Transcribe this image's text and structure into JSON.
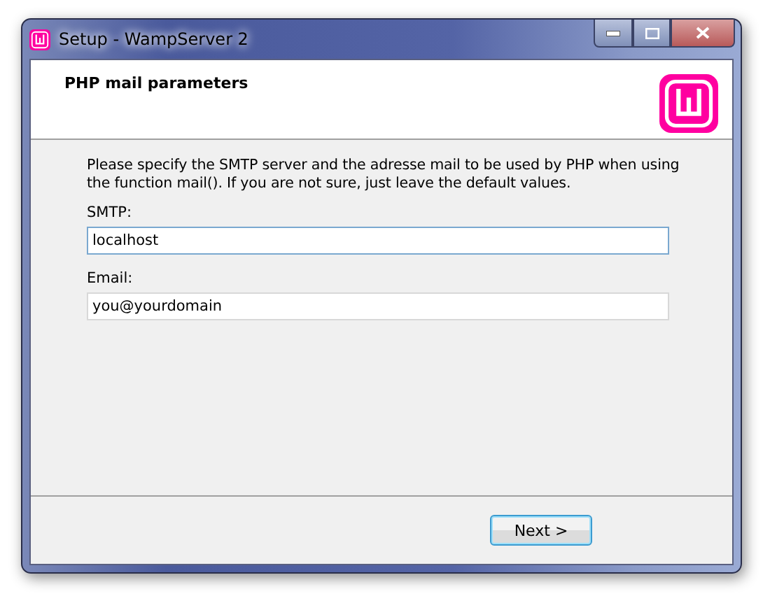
{
  "window": {
    "title": "Setup - WampServer 2"
  },
  "header": {
    "title": "PHP mail parameters"
  },
  "description": "Please specify the SMTP server and the adresse mail to be used by PHP when using the function mail(). If you are not sure, just leave the default values.",
  "fields": [
    {
      "label": "SMTP:",
      "value": "localhost",
      "focused": true
    },
    {
      "label": "Email:",
      "value": "you@yourdomain",
      "focused": false
    }
  ],
  "buttons": [
    {
      "label": "Next >"
    }
  ]
}
